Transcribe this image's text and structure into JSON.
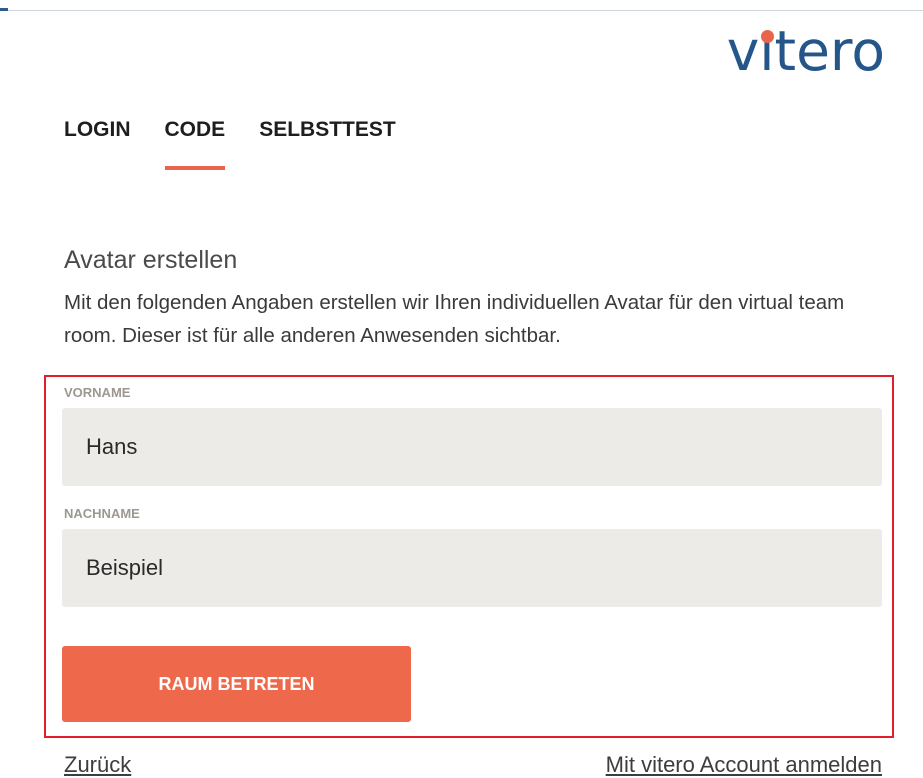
{
  "brand": {
    "logo_prefix": "v",
    "logo_i": "ı",
    "logo_suffix": "tero"
  },
  "tabs": [
    {
      "label": "LOGIN",
      "active": false
    },
    {
      "label": "CODE",
      "active": true
    },
    {
      "label": "SELBSTTEST",
      "active": false
    }
  ],
  "section": {
    "title": "Avatar erstellen",
    "intro": "Mit den folgenden Angaben erstellen wir Ihren individuellen Avatar für den virtual team room. Dieser ist für alle anderen Anwesenden sichtbar."
  },
  "form": {
    "first_name_label": "VORNAME",
    "first_name_value": "Hans",
    "last_name_label": "NACHNAME",
    "last_name_value": "Beispiel",
    "submit_label": "RAUM BETRETEN"
  },
  "links": {
    "back": "Zurück",
    "account": "Mit vitero Account anmelden"
  },
  "colors": {
    "accent": "#e8654b",
    "logo_blue": "#24568a",
    "highlight": "#e21d2c",
    "field_bg": "#ecebe8"
  }
}
